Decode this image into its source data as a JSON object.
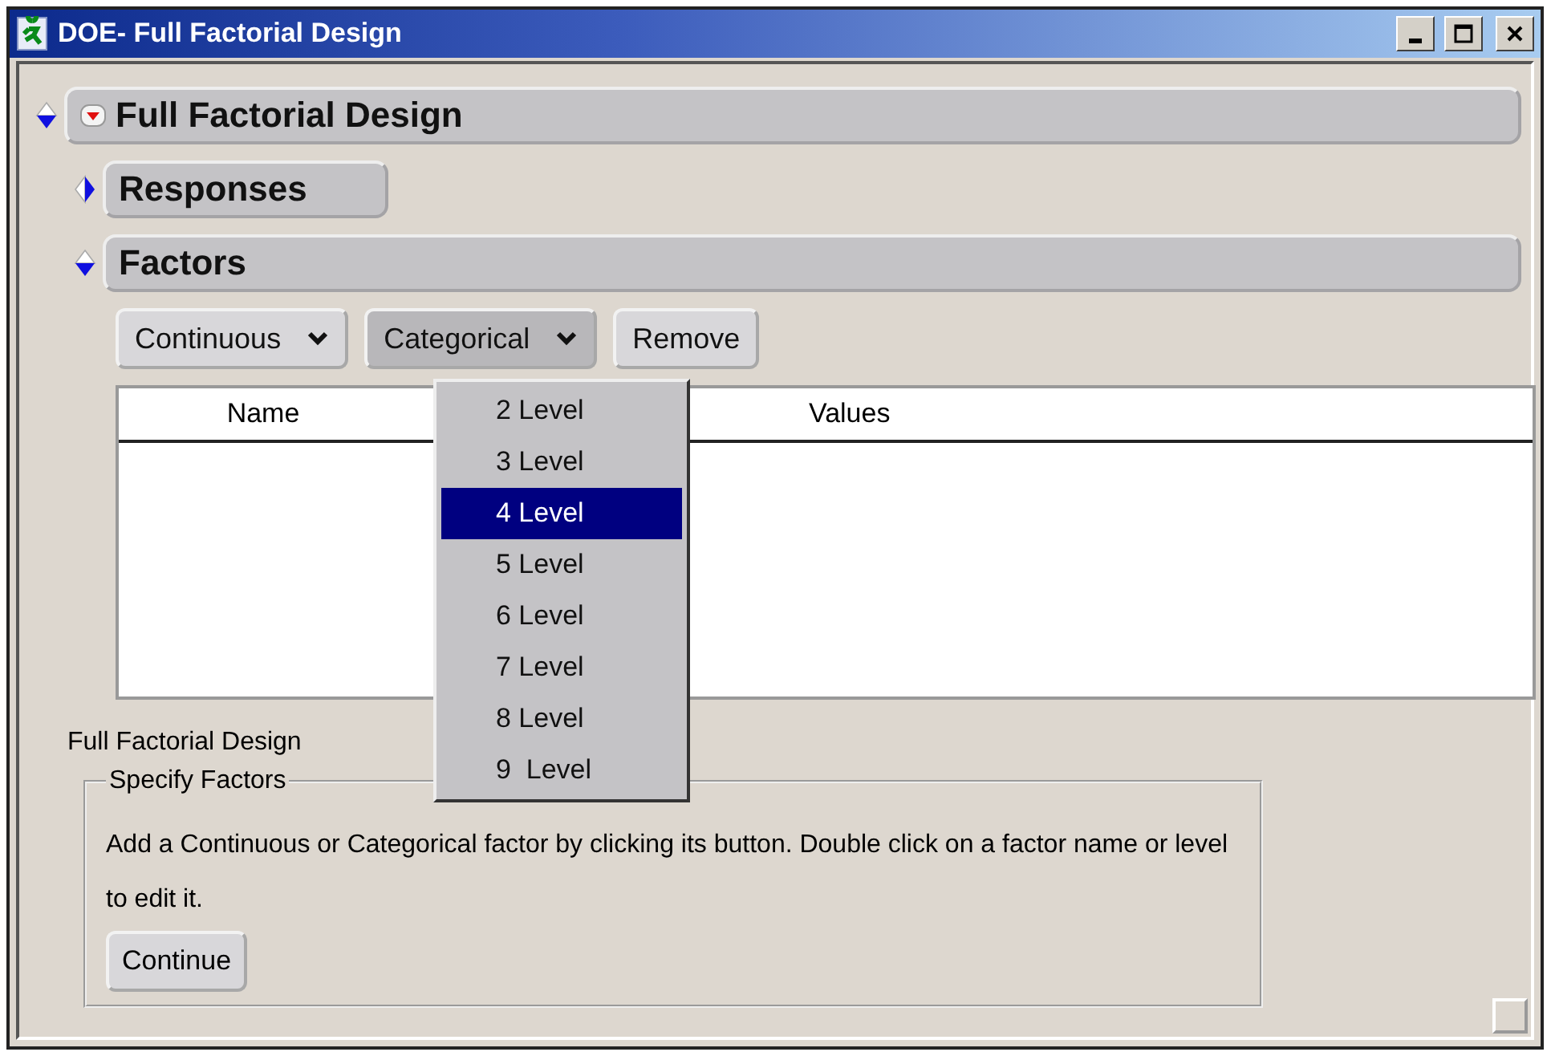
{
  "window": {
    "title": "DOE- Full Factorial Design"
  },
  "outline": {
    "title": "Full Factorial Design",
    "expanded": true,
    "sections": [
      {
        "title": "Responses",
        "expanded": false
      },
      {
        "title": "Factors",
        "expanded": true
      }
    ]
  },
  "factor_buttons": [
    {
      "kind": "dropdown",
      "label": "Continuous",
      "pressed": false
    },
    {
      "kind": "dropdown",
      "label": "Categorical",
      "pressed": true
    },
    {
      "kind": "button",
      "label": "Remove",
      "pressed": false
    }
  ],
  "table": {
    "columns": [
      "Name",
      "Values"
    ]
  },
  "menu": {
    "items": [
      {
        "label": "2 Level",
        "selected": false
      },
      {
        "label": "3 Level",
        "selected": false
      },
      {
        "label": "4 Level",
        "selected": true
      },
      {
        "label": "5 Level",
        "selected": false
      },
      {
        "label": "6 Level",
        "selected": false
      },
      {
        "label": "7 Level",
        "selected": false
      },
      {
        "label": "8 Level",
        "selected": false
      },
      {
        "label": "9  Level",
        "selected": false
      }
    ]
  },
  "caption": "Full Factorial Design",
  "group": {
    "legend": "Specify Factors",
    "text": "Add a Continuous or Categorical factor by clicking its button. Double click on a factor name or level to edit it.",
    "button": "Continue"
  }
}
